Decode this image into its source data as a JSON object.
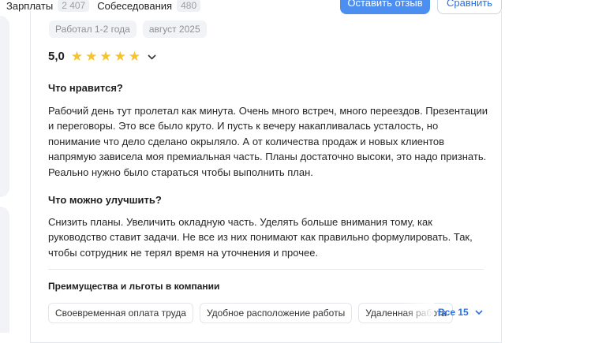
{
  "nav": {
    "tabs": [
      {
        "label": "Зарплаты",
        "count": "2 407"
      },
      {
        "label": "Собеседования",
        "count": "480"
      }
    ],
    "leave_review_button": "Оставить отзыв",
    "compare_button": "Сравнить"
  },
  "review": {
    "tags": [
      "Работал 1-2 года",
      "август 2025"
    ],
    "rating": "5,0",
    "stars": 5,
    "likes_title": "Что нравится?",
    "likes_text": "Рабочий день тут пролетал как минута. Очень много встреч, много переездов. Презентации и переговоры. Это все было круто. И пусть к вечеру накапливалась усталость, но понимание что дело сделано окрыляло. А от количества продаж и новых клиентов напрямую зависела моя премиальная часть. Планы достаточно высоки, это надо признать. Реально нужно было стараться чтобы выполнить план.",
    "improve_title": "Что можно улучшить?",
    "improve_text": "Снизить планы. Увеличить окладную часть. Уделять больше внимания тому, как руководство ставит задачи. Не все из них понимают как правильно формулировать. Так, чтобы сотрудник не терял время на уточнения и прочее.",
    "benefits_title": "Преимущества и льготы в компании",
    "benefits": [
      "Своевременная оплата труда",
      "Удобное расположение работы",
      "Удаленная работа"
    ],
    "show_all": "Все 15"
  },
  "colors": {
    "accent": "#4d8ff1",
    "link": "#2a6fe0",
    "star": "#f6c32c"
  }
}
